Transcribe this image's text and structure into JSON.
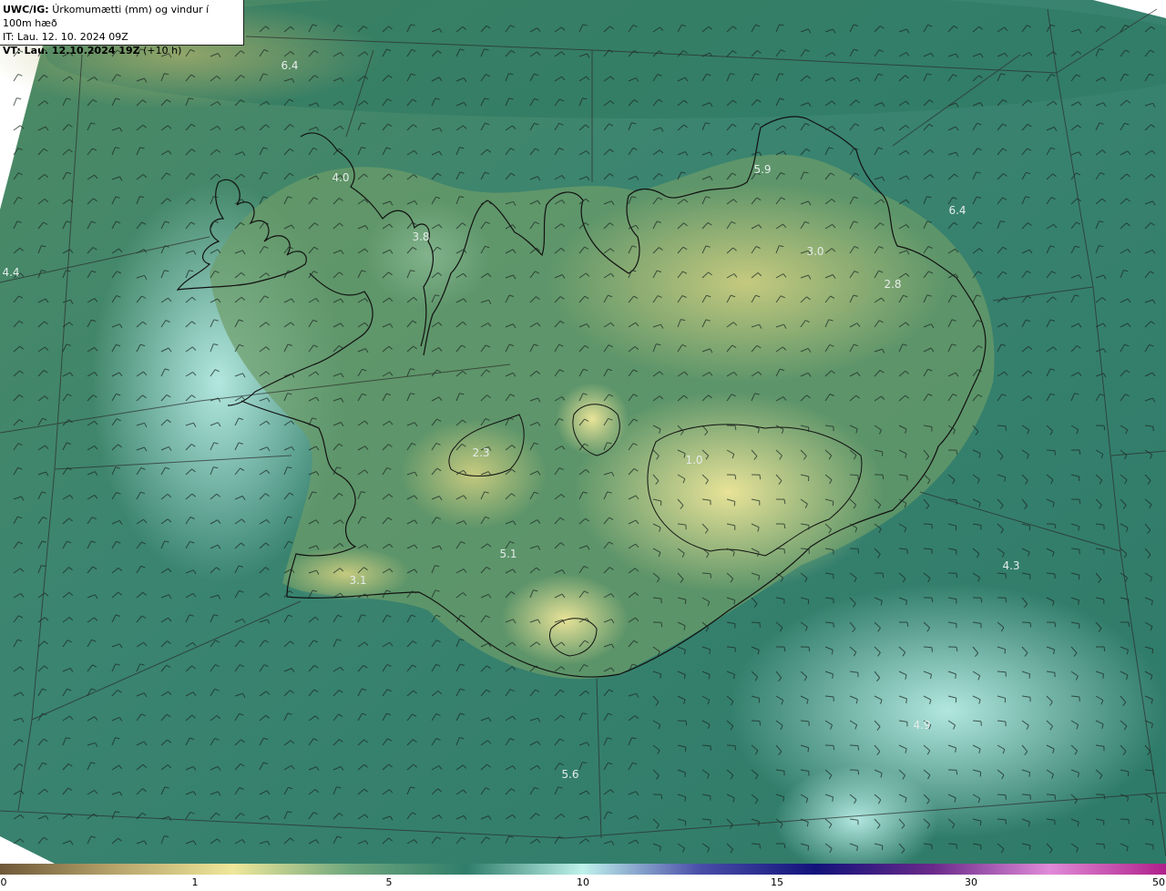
{
  "header": {
    "product": "UWC/IG:",
    "title": "Úrkomumætti (mm) og vindur í 100m hæð",
    "initial_time": "IT: Lau. 12. 10. 2024 09Z",
    "valid_label": "VT: Lau. 12.10.2024 19Z",
    "valid_offset": "(+10 h)"
  },
  "map_values": [
    {
      "text": "6.4"
    },
    {
      "text": "4.0"
    },
    {
      "text": "3.8"
    },
    {
      "text": "4.4"
    },
    {
      "text": "5.9"
    },
    {
      "text": "6.4"
    },
    {
      "text": "3.0"
    },
    {
      "text": "2.8"
    },
    {
      "text": "2.3"
    },
    {
      "text": "1.0"
    },
    {
      "text": "5.1"
    },
    {
      "text": "3.1"
    },
    {
      "text": "4.3"
    },
    {
      "text": "4.9"
    },
    {
      "text": "5.6"
    }
  ],
  "colorbar": {
    "ticks": [
      "0",
      "1",
      "5",
      "10",
      "15",
      "30",
      "50"
    ],
    "colors": [
      "#6e5838",
      "#b8a56c",
      "#efe79a",
      "#6fa77e",
      "#2f7d6a",
      "#bff2ec",
      "#4a4ea8",
      "#12127a",
      "#6a2a8a",
      "#e08ad8",
      "#b0208a"
    ]
  },
  "palette": {
    "sea_dark": "#2f7b68",
    "sea_mid": "#3d8c74",
    "sea_light": "#8fd0c4",
    "land_green": "#6a9f6a",
    "land_yellow": "#d8d882",
    "coast": "#1a1a1a"
  }
}
